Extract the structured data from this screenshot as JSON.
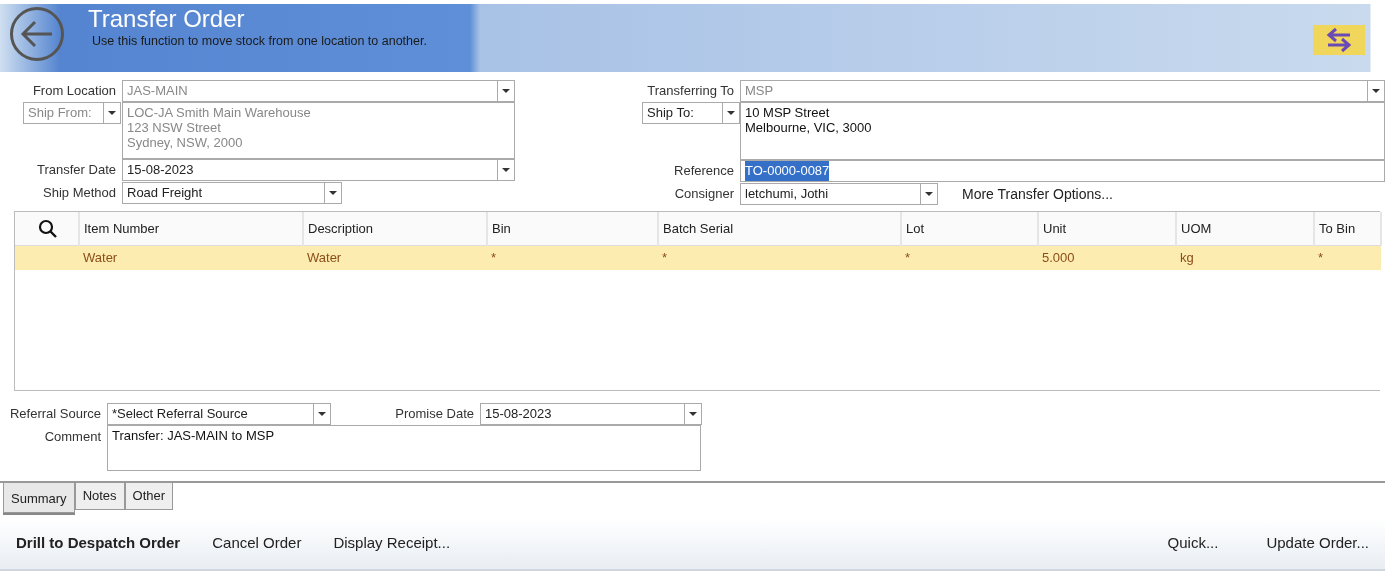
{
  "header": {
    "title": "Transfer Order",
    "subtitle": "Use this function to move stock from one location to another."
  },
  "from": {
    "disabled": true,
    "location_label": "From Location",
    "location": "JAS-MAIN",
    "ship_from": "Ship From:",
    "address": [
      "LOC-JA Smith Main Warehouse",
      "123 NSW Street",
      "Sydney, NSW, 2000"
    ],
    "date_label": "Transfer Date",
    "date": "15-08-2023",
    "method_label": "Ship Method",
    "method": "Road Freight"
  },
  "to": {
    "location_label": "Transferring To",
    "location": "MSP",
    "ship_to": "Ship To:",
    "address": [
      "10 MSP Street",
      "Melbourne, VIC, 3000"
    ],
    "reference_label": "Reference",
    "reference": {
      "value": "TO-0000-0087",
      "selected": true
    },
    "consigner_label": "Consigner",
    "consigner": "letchumi, Jothi",
    "more_link": "More Transfer Options..."
  },
  "grid": {
    "columns": [
      "Item Number",
      "Description",
      "Bin",
      "Batch Serial",
      "Lot",
      "Unit",
      "UOM",
      "To Bin"
    ],
    "rows": [
      {
        "selected": true,
        "cells": [
          "Water",
          "Water",
          "*",
          "*",
          "*",
          "5.000",
          "kg",
          "*"
        ]
      }
    ]
  },
  "extra": {
    "referral_label": "Referral Source",
    "referral": "*Select Referral Source",
    "promise_label": "Promise Date",
    "promise": "15-08-2023",
    "comment_label": "Comment",
    "comment": "Transfer: JAS-MAIN to MSP"
  },
  "tabs": [
    {
      "label": "Summary",
      "selected": true
    },
    {
      "label": "Notes",
      "selected": false
    },
    {
      "label": "Other",
      "selected": false
    }
  ],
  "actions": [
    {
      "label": "Drill to Despatch Order",
      "bold": true
    },
    {
      "label": "Cancel Order",
      "bold": false
    },
    {
      "label": "Display Receipt...",
      "bold": false
    }
  ],
  "right_actions": [
    {
      "label": "Quick...",
      "bold": false
    },
    {
      "label": "Update Order...",
      "bold": false
    }
  ]
}
